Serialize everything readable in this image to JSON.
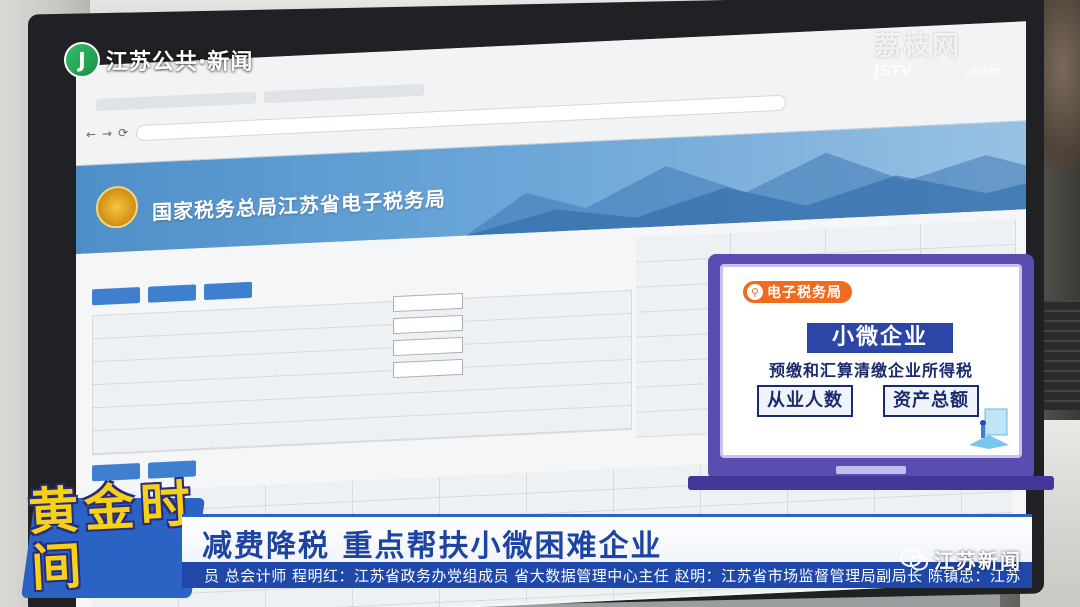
{
  "channel": {
    "logo_mark": "J",
    "name": "江苏公共·新闻"
  },
  "watermark": {
    "main": "荔枝网",
    "sub": "JSTV",
    "sub2": ".com"
  },
  "screen": {
    "site_title": "国家税务总局江苏省电子税务局"
  },
  "info_card": {
    "search_label": "电子税务局",
    "search_icon": "search-icon",
    "title": "小微企业",
    "description": "预缴和汇算清缴企业所得税",
    "tags": [
      "从业人数",
      "资产总额"
    ],
    "colors": {
      "frame": "#5a4db0",
      "pill": "#ef6b1f",
      "title_bg": "#2c46a8",
      "text": "#1a2a6e"
    }
  },
  "program": {
    "logo_text": "黄金时间"
  },
  "lower_third": {
    "headline": "减费降税  重点帮扶小微困难企业",
    "ticker": "员 总会计师  程明红：江苏省政务办党组成员 省大数据管理中心主任  赵明：江苏省市场监督管理局副局长  陈镇忠：江苏",
    "colors": {
      "headline_text": "#1d44a0",
      "ticker_bg": "#1f48a8"
    }
  },
  "social": {
    "icon": "wechat-icon",
    "label": "江苏新闻"
  }
}
